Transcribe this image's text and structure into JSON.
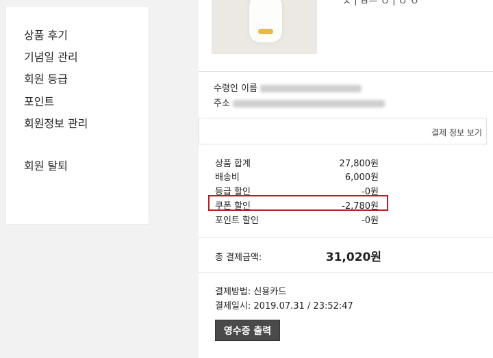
{
  "sidebar": {
    "items": [
      {
        "label": "상품 후기"
      },
      {
        "label": "기념일 관리"
      },
      {
        "label": "회원 등급"
      },
      {
        "label": "포인트"
      },
      {
        "label": "회원정보 관리"
      },
      {
        "label": "회원 탈퇴"
      }
    ]
  },
  "product": {
    "name_partial": "ㅅㅣㅂㅡ ㅇㅣㅇ ㅇ"
  },
  "recipient": {
    "name_label": "수령인 이름",
    "address_label": "주소"
  },
  "payment_info_link": "결제 정보 보기",
  "summary": {
    "rows": [
      {
        "label": "상품 합계",
        "value": "27,800원"
      },
      {
        "label": "배송비",
        "value": "6,000원"
      },
      {
        "label": "등급 할인",
        "value": "-0원"
      },
      {
        "label": "쿠폰 할인",
        "value": "-2,780원"
      },
      {
        "label": "포인트 할인",
        "value": "-0원"
      }
    ],
    "total_label": "총 결제금액:",
    "total_value": "31,020원"
  },
  "payment": {
    "method": "결제방법: 신용카드",
    "datetime": "결제일시: 2019.07.31 / 23:52:47"
  },
  "receipt_button": "영수증 출력",
  "colors": {
    "highlight": "#b3202a",
    "button_bg": "#4a4a4a"
  }
}
